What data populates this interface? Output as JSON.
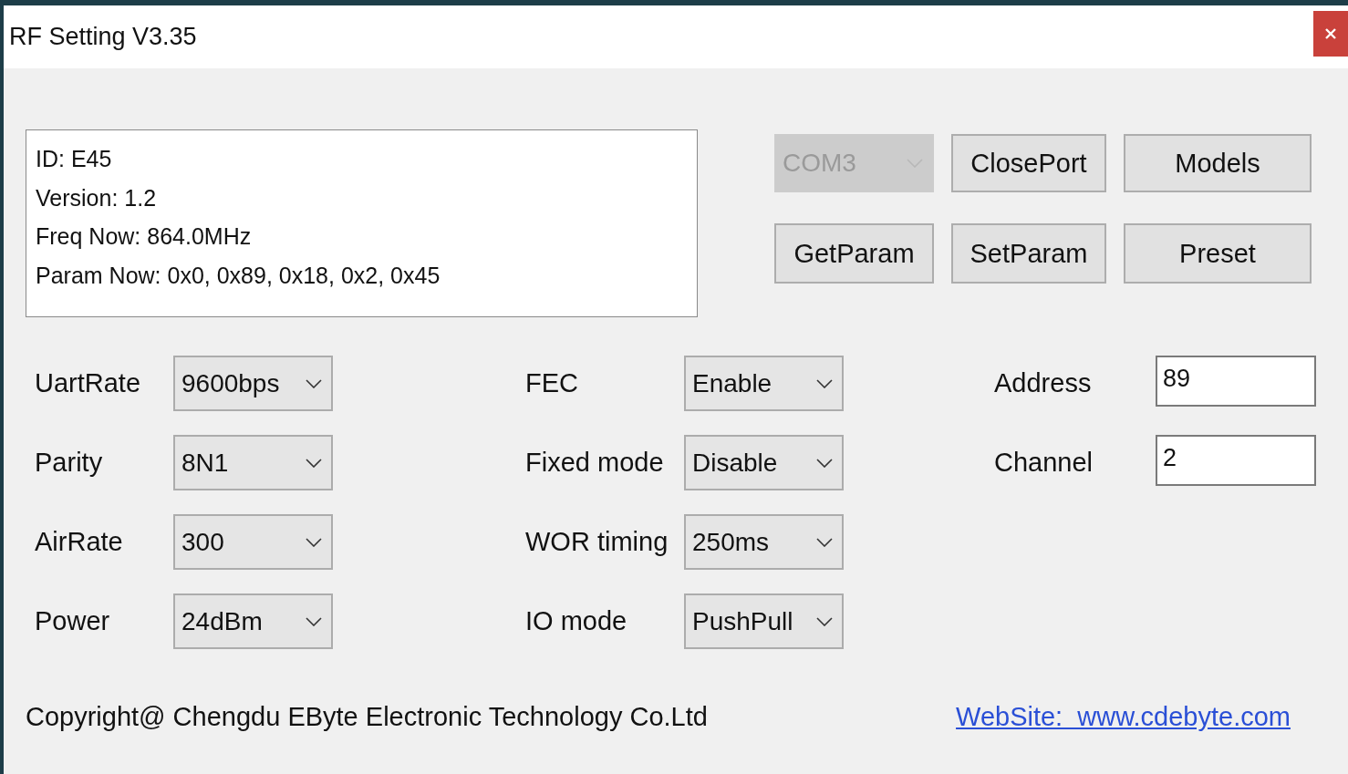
{
  "window": {
    "title": "RF Setting V3.35"
  },
  "info_lines": [
    "ID: E45",
    "Version: 1.2",
    "Freq Now: 864.0MHz",
    "Param Now: 0x0, 0x89, 0x18, 0x2, 0x45"
  ],
  "port": {
    "value": "COM3",
    "disabled": true
  },
  "buttons": [
    "ClosePort",
    "Models",
    "GetParam",
    "SetParam",
    "Preset"
  ],
  "left_fields": [
    {
      "label": "UartRate",
      "value": "9600bps"
    },
    {
      "label": "Parity",
      "value": "8N1"
    },
    {
      "label": "AirRate",
      "value": "300"
    },
    {
      "label": "Power",
      "value": "24dBm"
    }
  ],
  "middle_fields": [
    {
      "label": "FEC",
      "value": "Enable"
    },
    {
      "label": "Fixed mode",
      "value": "Disable"
    },
    {
      "label": "WOR timing",
      "value": "250ms"
    },
    {
      "label": "IO mode",
      "value": "PushPull"
    }
  ],
  "right_fields": [
    {
      "label": "Address",
      "value": "89"
    },
    {
      "label": "Channel",
      "value": "2"
    }
  ],
  "footer": {
    "copyright": "Copyright@ Chengdu EByte Electronic Technology Co.Ltd",
    "website": "WebSite:  www.cdebyte.com"
  }
}
